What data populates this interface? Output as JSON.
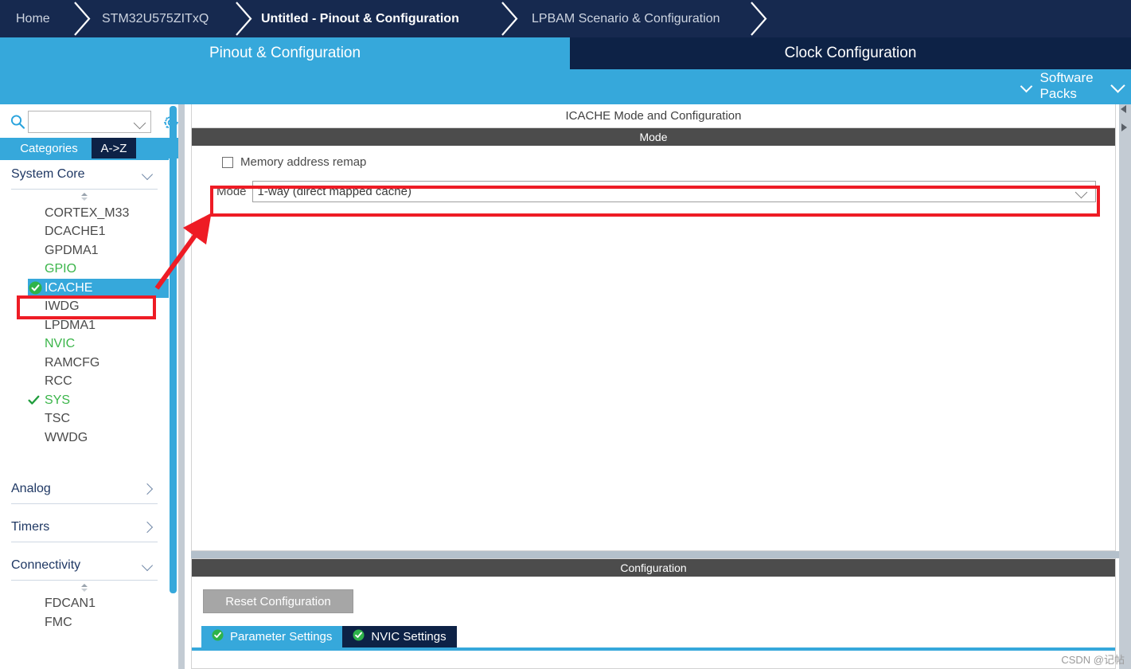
{
  "breadcrumb": {
    "items": [
      {
        "label": "Home",
        "active": false
      },
      {
        "label": "STM32U575ZITxQ",
        "active": false
      },
      {
        "label": "Untitled - Pinout & Configuration",
        "active": true
      },
      {
        "label": "LPBAM Scenario & Configuration",
        "active": false
      }
    ]
  },
  "main_tabs": [
    {
      "label": "Pinout & Configuration",
      "selected": true
    },
    {
      "label": "Clock Configuration",
      "selected": false
    }
  ],
  "toolbar": {
    "software_packs_label": "Software Packs",
    "chevron_down_icon": "chevron-down-icon",
    "edge_chevron_icon": "chevron-down-icon"
  },
  "sidebar": {
    "search": {
      "value": "",
      "placeholder": "",
      "icon": "search-icon",
      "dropdown_icon": "chevron-down-icon"
    },
    "gear_icon": "gear-icon",
    "tabs": [
      {
        "label": "Categories",
        "selected": true
      },
      {
        "label": "A->Z",
        "selected": false
      }
    ],
    "groups": [
      {
        "label": "System Core",
        "expanded": true,
        "items": [
          {
            "label": "CORTEX_M33",
            "state": "normal"
          },
          {
            "label": "DCACHE1",
            "state": "normal"
          },
          {
            "label": "GPDMA1",
            "state": "normal"
          },
          {
            "label": "GPIO",
            "state": "configured"
          },
          {
            "label": "ICACHE",
            "state": "selected"
          },
          {
            "label": "IWDG",
            "state": "normal"
          },
          {
            "label": "LPDMA1",
            "state": "normal"
          },
          {
            "label": "NVIC",
            "state": "configured"
          },
          {
            "label": "RAMCFG",
            "state": "normal"
          },
          {
            "label": "RCC",
            "state": "normal"
          },
          {
            "label": "SYS",
            "state": "checked"
          },
          {
            "label": "TSC",
            "state": "normal"
          },
          {
            "label": "WWDG",
            "state": "normal"
          }
        ]
      },
      {
        "label": "Analog",
        "expanded": false,
        "items": []
      },
      {
        "label": "Timers",
        "expanded": false,
        "items": []
      },
      {
        "label": "Connectivity",
        "expanded": true,
        "items": [
          {
            "label": "FDCAN1",
            "state": "normal"
          },
          {
            "label": "FMC",
            "state": "normal"
          }
        ]
      }
    ]
  },
  "upper_panel": {
    "title": "ICACHE Mode and Configuration",
    "mode_band": "Mode",
    "checkbox": {
      "label": "Memory address remap",
      "checked": false
    },
    "mode_field": {
      "label": "Mode",
      "value": "1-way (direct mapped cache)",
      "caret_icon": "chevron-down-icon"
    }
  },
  "lower_panel": {
    "band": "Configuration",
    "reset_button": "Reset Configuration",
    "tabs": [
      {
        "label": "Parameter Settings",
        "selected": true,
        "status_icon": "check-circle-icon"
      },
      {
        "label": "NVIC Settings",
        "selected": false,
        "status_icon": "check-circle-icon"
      }
    ]
  },
  "annotations": {
    "arrow_icon": "red-arrow-icon",
    "highlight_color": "#ee1c25"
  },
  "watermark": "CSDN @记帖",
  "colors": {
    "brand_dark": "#16294f",
    "brand_blue": "#36a8db",
    "tab_navy": "#0d2246",
    "band_gray": "#4c4c4c",
    "green": "#3bb54a",
    "annotation_red": "#ee1c25"
  }
}
